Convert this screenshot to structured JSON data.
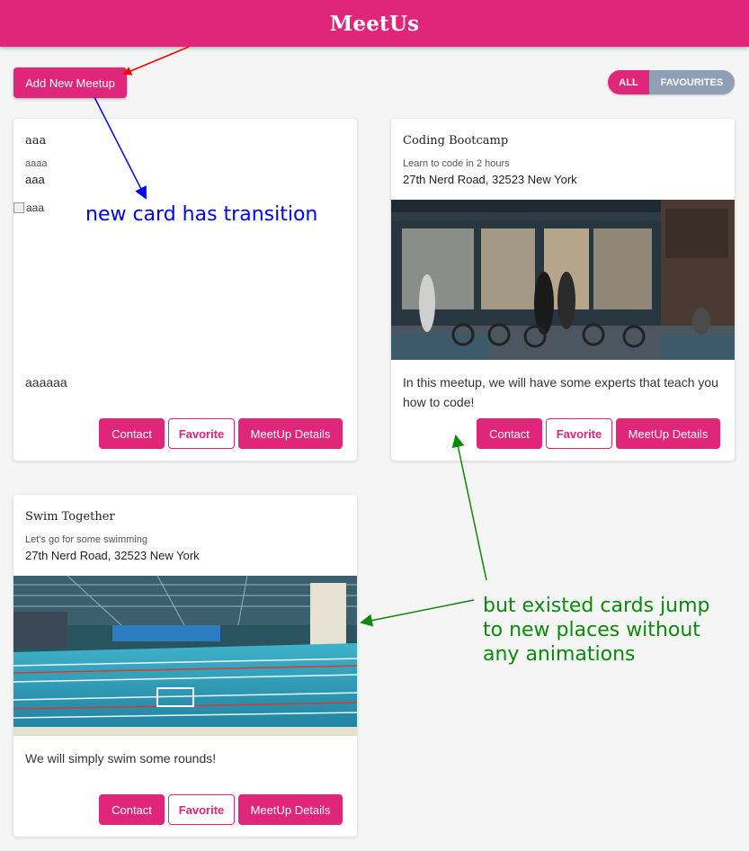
{
  "app": {
    "title": "MeetUs"
  },
  "toolbar": {
    "add_label": "Add New Meetup"
  },
  "filter": {
    "all_label": "ALL",
    "favourites_label": "FAVOURITES",
    "active": "ALL"
  },
  "cards": [
    {
      "title": "aaa",
      "subtitle": "aaaa",
      "address": "aaa",
      "image_alt": "aaa",
      "description": "aaaaaa",
      "actions": {
        "contact": "Contact",
        "favorite": "Favorite",
        "details": "MeetUp Details"
      }
    },
    {
      "title": "Coding Bootcamp",
      "subtitle": "Learn to code in 2 hours",
      "address": "27th Nerd Road, 32523 New York",
      "image_alt": "",
      "description": "In this meetup, we will have some experts that teach you how to code!",
      "actions": {
        "contact": "Contact",
        "favorite": "Favorite",
        "details": "MeetUp Details"
      }
    },
    {
      "title": "Swim Together",
      "subtitle": "Let's go for some swimming",
      "address": "27th Nerd Road, 32523 New York",
      "image_alt": "",
      "description": "We will simply swim some rounds!",
      "actions": {
        "contact": "Contact",
        "favorite": "Favorite",
        "details": "MeetUp Details"
      }
    }
  ],
  "annotations": {
    "transition_note": "new card has transition",
    "jump_note_line1": "but existed cards jump",
    "jump_note_line2": "to new places without",
    "jump_note_line3": "any animations"
  },
  "colors": {
    "accent": "#e0267a",
    "toggle_inactive": "#8f9fb6",
    "annotation_blue": "#0000ff",
    "annotation_green": "#0a8a0a",
    "annotation_red": "#ff0000"
  }
}
